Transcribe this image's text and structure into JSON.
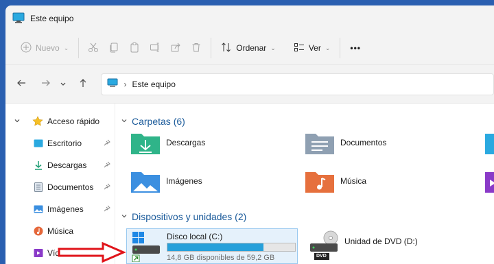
{
  "window": {
    "title": "Este equipo"
  },
  "toolbar": {
    "new_label": "Nuevo",
    "sort_label": "Ordenar",
    "view_label": "Ver",
    "more_label": "•••"
  },
  "address": {
    "path": "Este equipo"
  },
  "sidebar": {
    "quick_access": "Acceso rápido",
    "items": [
      {
        "label": "Escritorio",
        "icon": "desktop-icon"
      },
      {
        "label": "Descargas",
        "icon": "downloads-icon"
      },
      {
        "label": "Documentos",
        "icon": "documents-icon"
      },
      {
        "label": "Imágenes",
        "icon": "pictures-icon"
      },
      {
        "label": "Música",
        "icon": "music-icon"
      },
      {
        "label": "Vídeos",
        "icon": "videos-icon"
      }
    ]
  },
  "folders": {
    "header": "Carpetas (6)",
    "items": [
      {
        "label": "Descargas"
      },
      {
        "label": "Documentos"
      },
      {
        "label": "Imágenes"
      },
      {
        "label": "Música"
      }
    ]
  },
  "drives": {
    "header": "Dispositivos y unidades (2)",
    "local": {
      "name": "Disco local (C:)",
      "free_text": "14,8 GB disponibles de 59,2 GB",
      "used_fraction": 0.75
    },
    "dvd": {
      "name": "Unidad de DVD (D:)",
      "badge": "DVD"
    }
  },
  "colors": {
    "accent": "#26a0da",
    "link_blue": "#1a5a9a",
    "arrow_red": "#e0141a"
  }
}
